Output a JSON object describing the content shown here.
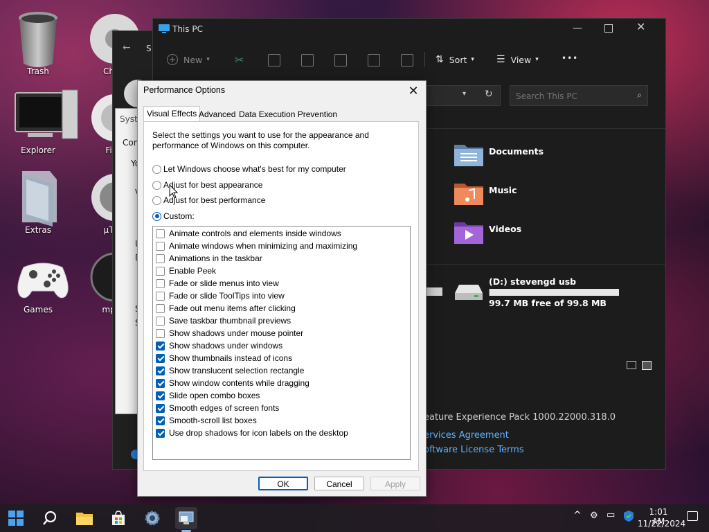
{
  "desktop": {
    "icons": [
      {
        "label": "Trash"
      },
      {
        "label": "Explorer"
      },
      {
        "label": "Extras"
      },
      {
        "label": "Games"
      },
      {
        "label": "Ch"
      },
      {
        "label": "Fi"
      },
      {
        "label": "µT"
      },
      {
        "label": "mp"
      }
    ]
  },
  "back_window_1": {
    "title_fragment": "S"
  },
  "back_window_2": {
    "title_fragment": "Syste",
    "text_fragments": [
      "Com",
      "Yo",
      "V",
      "U",
      "D",
      "S",
      "S"
    ]
  },
  "explorer": {
    "title": "This PC",
    "toolbar": {
      "new_label": "New",
      "sort_label": "Sort",
      "view_label": "View",
      "more_label": "•••"
    },
    "search": {
      "placeholder": "Search This PC"
    },
    "folders": [
      {
        "label": "Documents",
        "color": "#7aa6d6"
      },
      {
        "label": "Music",
        "color": "#e8794a"
      },
      {
        "label": "Videos",
        "color": "#9b59d0"
      }
    ],
    "drive": {
      "label": "(D:) stevengd usb",
      "free_text": "99.7 MB free of 99.8 MB",
      "used_fraction": 0.001
    }
  },
  "about_fragments": {
    "experience_pack": "eature Experience Pack 1000.22000.318.0",
    "services_link": "ervices Agreement",
    "license_link": "oftware License Terms"
  },
  "dialog": {
    "title": "Performance Options",
    "tabs": [
      {
        "label": "Visual Effects",
        "active": true
      },
      {
        "label": "Advanced",
        "active": false
      },
      {
        "label": "Data Execution Prevention",
        "active": false
      }
    ],
    "description": "Select the settings you want to use for the appearance and performance of Windows on this computer.",
    "radios": [
      {
        "label": "Let Windows choose what's best for my computer",
        "checked": false
      },
      {
        "label": "Adjust for best appearance",
        "checked": false
      },
      {
        "label": "Adjust for best performance",
        "checked": false
      },
      {
        "label": "Custom:",
        "checked": true
      }
    ],
    "options": [
      {
        "label": "Animate controls and elements inside windows",
        "checked": false
      },
      {
        "label": "Animate windows when minimizing and maximizing",
        "checked": false
      },
      {
        "label": "Animations in the taskbar",
        "checked": false
      },
      {
        "label": "Enable Peek",
        "checked": false
      },
      {
        "label": "Fade or slide menus into view",
        "checked": false
      },
      {
        "label": "Fade or slide ToolTips into view",
        "checked": false
      },
      {
        "label": "Fade out menu items after clicking",
        "checked": false
      },
      {
        "label": "Save taskbar thumbnail previews",
        "checked": false
      },
      {
        "label": "Show shadows under mouse pointer",
        "checked": false
      },
      {
        "label": "Show shadows under windows",
        "checked": true
      },
      {
        "label": "Show thumbnails instead of icons",
        "checked": true
      },
      {
        "label": "Show translucent selection rectangle",
        "checked": true
      },
      {
        "label": "Show window contents while dragging",
        "checked": true
      },
      {
        "label": "Slide open combo boxes",
        "checked": true
      },
      {
        "label": "Smooth edges of screen fonts",
        "checked": true
      },
      {
        "label": "Smooth-scroll list boxes",
        "checked": true
      },
      {
        "label": "Use drop shadows for icon labels on the desktop",
        "checked": true
      }
    ],
    "buttons": {
      "ok": "OK",
      "cancel": "Cancel",
      "apply": "Apply"
    }
  },
  "taskbar": {
    "time": "1:01 AM",
    "date": "11/22/2024",
    "icons": [
      "windows-start-icon",
      "search-icon",
      "file-explorer-icon",
      "store-icon",
      "settings-icon",
      "system-properties-icon"
    ]
  }
}
